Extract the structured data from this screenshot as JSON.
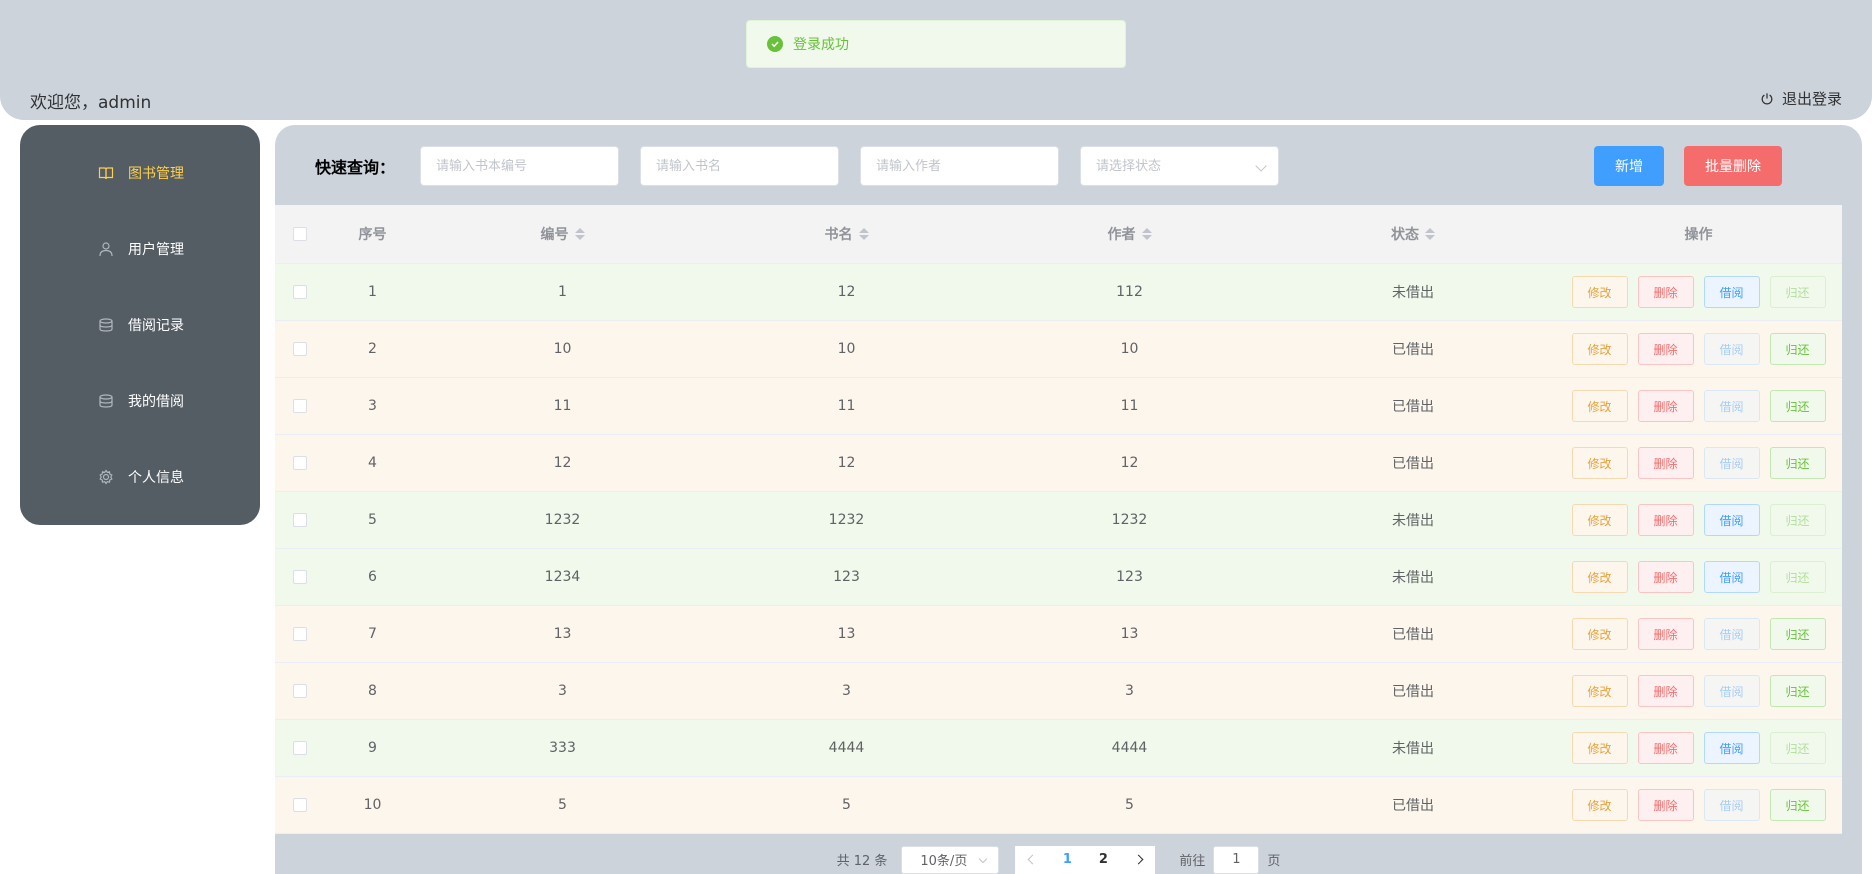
{
  "header": {
    "welcome": "欢迎您，admin",
    "logout_label": "退出登录"
  },
  "toast": {
    "message": "登录成功"
  },
  "sidebar": {
    "items": [
      {
        "label": "图书管理",
        "icon": "book-icon",
        "active": true
      },
      {
        "label": "用户管理",
        "icon": "user-icon",
        "active": false
      },
      {
        "label": "借阅记录",
        "icon": "coins-icon",
        "active": false
      },
      {
        "label": "我的借阅",
        "icon": "coins-icon",
        "active": false
      },
      {
        "label": "个人信息",
        "icon": "gear-icon",
        "active": false
      }
    ]
  },
  "search": {
    "label": "快速查询：",
    "book_no_placeholder": "请输入书本编号",
    "book_name_placeholder": "请输入书名",
    "author_placeholder": "请输入作者",
    "status_placeholder": "请选择状态",
    "add_label": "新增",
    "batch_delete_label": "批量删除"
  },
  "table": {
    "columns": {
      "index": "序号",
      "number": "编号",
      "name": "书名",
      "author": "作者",
      "status": "状态",
      "ops": "操作"
    },
    "op_labels": {
      "edit": "修改",
      "delete": "删除",
      "borrow": "借阅",
      "return": "归还"
    },
    "rows": [
      {
        "index": "1",
        "number": "1",
        "name": "12",
        "author": "112",
        "status": "未借出"
      },
      {
        "index": "2",
        "number": "10",
        "name": "10",
        "author": "10",
        "status": "已借出"
      },
      {
        "index": "3",
        "number": "11",
        "name": "11",
        "author": "11",
        "status": "已借出"
      },
      {
        "index": "4",
        "number": "12",
        "name": "12",
        "author": "12",
        "status": "已借出"
      },
      {
        "index": "5",
        "number": "1232",
        "name": "1232",
        "author": "1232",
        "status": "未借出"
      },
      {
        "index": "6",
        "number": "1234",
        "name": "123",
        "author": "123",
        "status": "未借出"
      },
      {
        "index": "7",
        "number": "13",
        "name": "13",
        "author": "13",
        "status": "已借出"
      },
      {
        "index": "8",
        "number": "3",
        "name": "3",
        "author": "3",
        "status": "已借出"
      },
      {
        "index": "9",
        "number": "333",
        "name": "4444",
        "author": "4444",
        "status": "未借出"
      },
      {
        "index": "10",
        "number": "5",
        "name": "5",
        "author": "5",
        "status": "已借出"
      }
    ]
  },
  "pagination": {
    "total": "共 12 条",
    "page_size": "10条/页",
    "pages": [
      "1",
      "2"
    ],
    "current_page": "1",
    "goto_prefix": "前往",
    "goto_value": "1",
    "goto_suffix": "页"
  }
}
